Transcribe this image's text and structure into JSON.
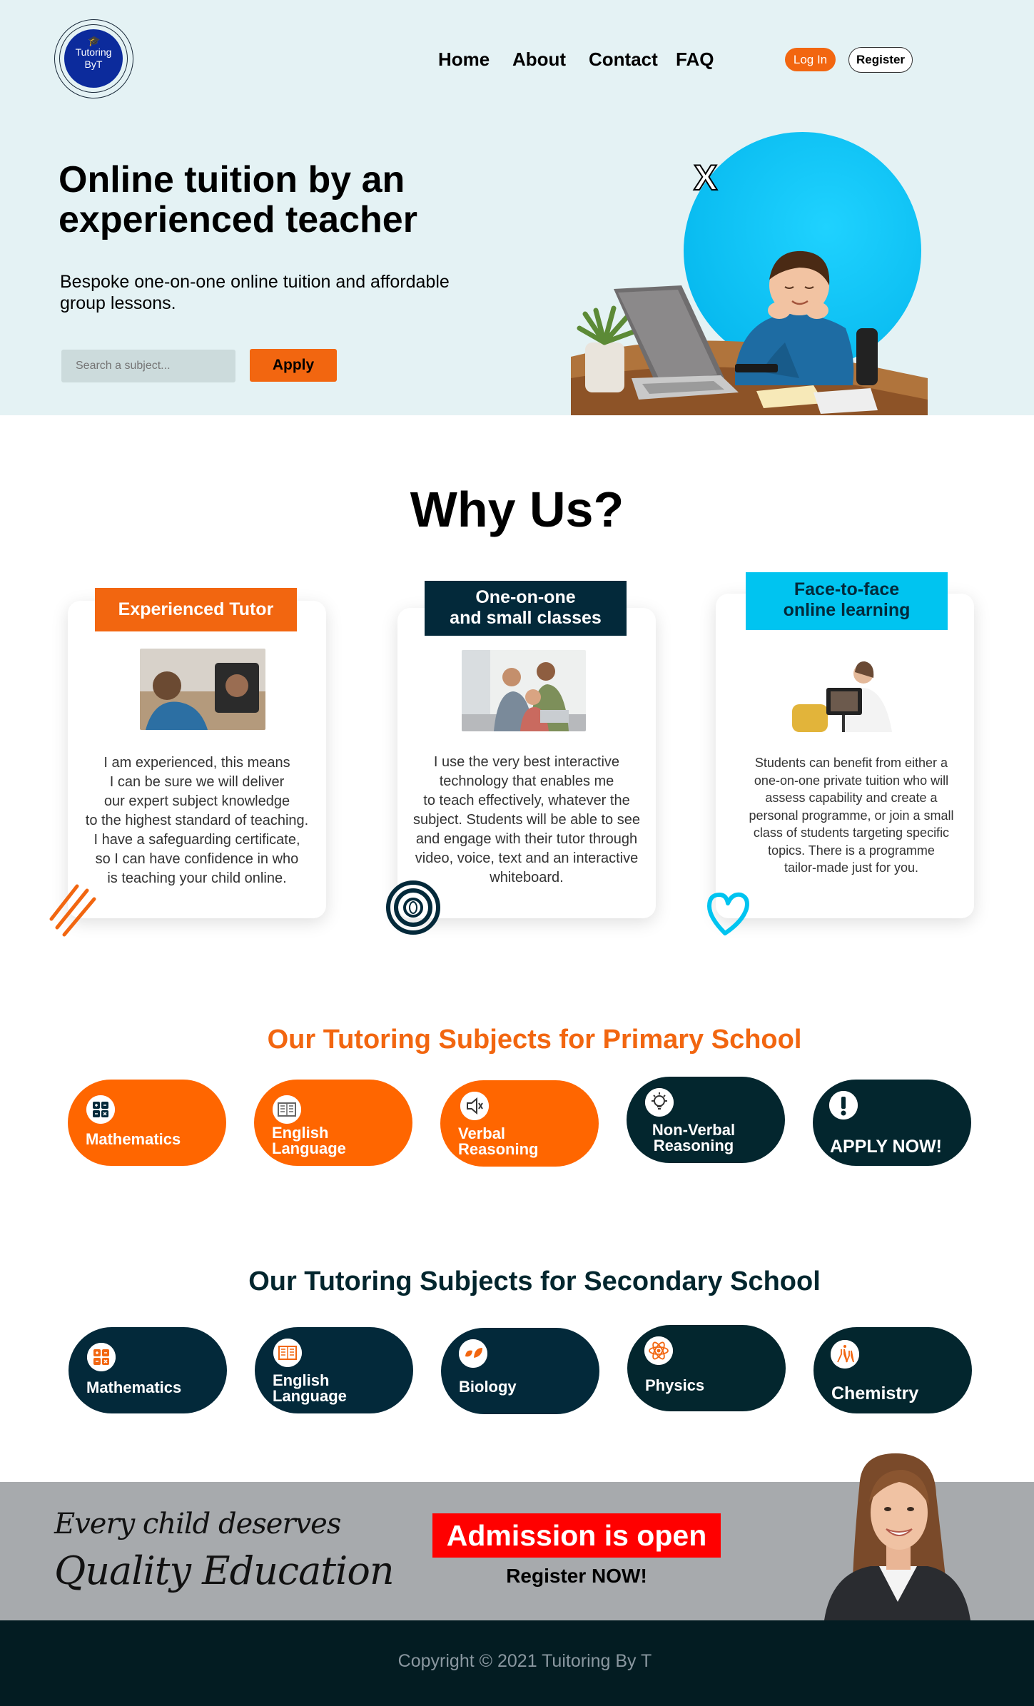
{
  "header": {
    "logo_text_line1": "Tutoring",
    "logo_text_line2": "ByT",
    "nav": [
      "Home",
      "About",
      "Contact",
      "FAQ"
    ],
    "login_label": "Log In",
    "register_label": "Register"
  },
  "hero": {
    "title": "Online tuition by an experienced teacher",
    "subtitle": "Bespoke one-on-one online tuition and affordable group lessons.",
    "search_placeholder": "Search a subject...",
    "apply_label": "Apply"
  },
  "why_us": {
    "title": "Why Us?",
    "cards": [
      {
        "heading": "Experienced Tutor",
        "text": "I am experienced, this means\nI can be sure we will deliver\nour expert subject knowledge\nto the highest standard of teaching.\nI have a safeguarding certificate,\nso I can have confidence in who\nis teaching your child online."
      },
      {
        "heading": "One-on-one\nand small classes",
        "text": "I use the very best interactive\ntechnology that enables me\nto teach effectively, whatever the\nsubject. Students will be able to see\nand engage with their tutor through\nvideo, voice, text and an interactive\nwhiteboard."
      },
      {
        "heading": "Face-to-face\nonline learning",
        "text": "Students can benefit from either a\none-on-one private tuition who will\nassess capability and create a\npersonal programme, or join a small\nclass of students targeting specific\ntopics. There is a programme\ntailor-made just for you."
      }
    ]
  },
  "primary": {
    "title": "Our Tutoring Subjects for Primary School",
    "subjects": [
      "Mathematics",
      "English\nLanguage",
      "Verbal\nReasoning",
      "Non-Verbal\nReasoning",
      "APPLY NOW!"
    ]
  },
  "secondary": {
    "title": "Our Tutoring Subjects for Secondary School",
    "subjects": [
      "Mathematics",
      "English\nLanguage",
      "Biology",
      "Physics",
      "Chemistry"
    ]
  },
  "banner": {
    "line1": "Every child deserves",
    "line2": "Quality Education",
    "admission": "Admission is open",
    "register_now": "Register NOW!"
  },
  "footer": {
    "copyright": "Copyright © 2021 Tuitoring By T"
  },
  "colors": {
    "orange": "#f26610",
    "navy": "#03293a",
    "cyan": "#00c4f0",
    "dark": "#031c22",
    "red": "#ff0000"
  }
}
